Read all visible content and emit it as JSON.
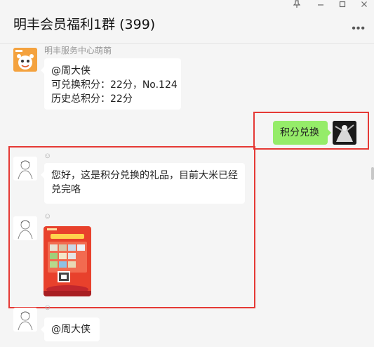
{
  "window": {
    "title": "明丰会员福利1群 (399)",
    "controls": [
      "pin-icon",
      "minimize-icon",
      "maximize-icon",
      "close-icon"
    ]
  },
  "messages": [
    {
      "sender": "明丰服务中心萌萌",
      "lines": [
        "@周大侠",
        "可兑换积分：22分，No.124",
        "历史总积分：22分"
      ]
    },
    {
      "self": true,
      "text": "积分兑换"
    },
    {
      "lines": [
        "您好，这是积分兑换的礼品，目前大米已经",
        "兑完咯"
      ]
    },
    {
      "image": "gift-poster"
    },
    {
      "lines": [
        "@周大侠"
      ]
    }
  ],
  "colors": {
    "background": "#f5f5f5",
    "self_bubble": "#95ec69",
    "highlight": "#e53935",
    "poster_red": "#e8412c"
  }
}
